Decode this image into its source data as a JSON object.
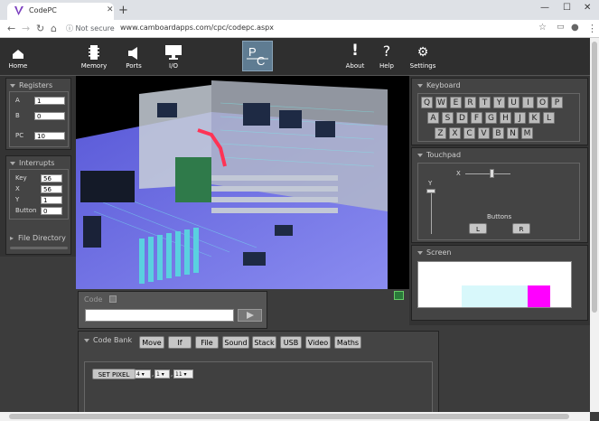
{
  "browser": {
    "tab_title": "CodePC",
    "new_tab": "+",
    "not_secure": "Not secure",
    "url": "www.camboardapps.com/cpc/codepc.aspx"
  },
  "toolbar": {
    "home": "Home",
    "memory": "Memory",
    "ports": "Ports",
    "io": "I/O",
    "about": "About",
    "help": "Help",
    "settings": "Settings"
  },
  "registers": {
    "title": "Registers",
    "rows": [
      {
        "label": "A",
        "value": "1"
      },
      {
        "label": "B",
        "value": "0"
      },
      {
        "label": "PC",
        "value": "10"
      }
    ]
  },
  "interrupts": {
    "title": "Interrupts",
    "rows": [
      {
        "label": "Key",
        "value": "56"
      },
      {
        "label": "X",
        "value": "56"
      },
      {
        "label": "Y",
        "value": "1"
      },
      {
        "label": "Button",
        "value": "0"
      }
    ]
  },
  "file_directory": "File Directory",
  "code": {
    "title": "Code",
    "value": ""
  },
  "code_bank": {
    "title": "Code Bank",
    "buttons": [
      "Move",
      "If",
      "File",
      "Sound",
      "Stack",
      "USB",
      "Video",
      "Maths"
    ],
    "statement": "SET PIXEL",
    "selects": [
      "4",
      "1",
      "11"
    ]
  },
  "keyboard": {
    "title": "Keyboard",
    "rows": [
      [
        "Q",
        "W",
        "E",
        "R",
        "T",
        "Y",
        "U",
        "I",
        "O",
        "P"
      ],
      [
        "A",
        "S",
        "D",
        "F",
        "G",
        "H",
        "J",
        "K",
        "L"
      ],
      [
        "Z",
        "X",
        "C",
        "V",
        "B",
        "N",
        "M"
      ]
    ]
  },
  "touchpad": {
    "title": "Touchpad",
    "x_label": "X",
    "y_label": "Y",
    "buttons_label": "Buttons",
    "left": "L",
    "right": "R",
    "x_value": 0.6,
    "y_value": 0.0
  },
  "screen": {
    "title": "Screen",
    "colors": {
      "cyan": "#d8f8fb",
      "magenta": "#ff00ff"
    }
  }
}
